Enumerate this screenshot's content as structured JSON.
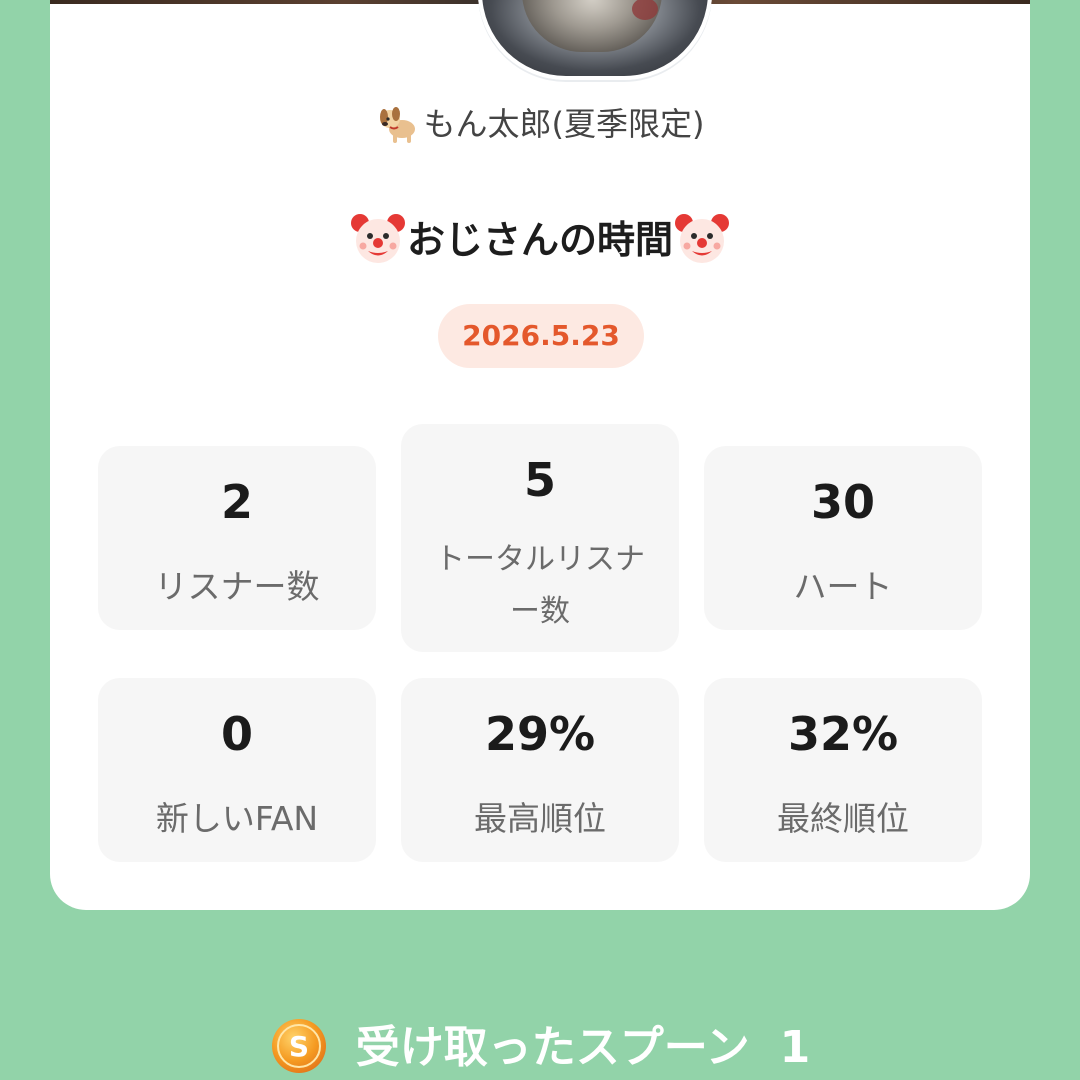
{
  "profile": {
    "owner_name": "もん太郎(夏季限定)",
    "owner_emoji": "dog-emoji",
    "avatar": "dog-avatar"
  },
  "broadcast": {
    "title": "おじさんの時間",
    "title_emoji": "clown-face-emoji",
    "date": "2026.5.23"
  },
  "stats": [
    {
      "value": "2",
      "label": "リスナー数"
    },
    {
      "value": "5",
      "label": "トータルリスナー数"
    },
    {
      "value": "30",
      "label": "ハート"
    },
    {
      "value": "0",
      "label": "新しいFAN"
    },
    {
      "value": "29%",
      "label": "最高順位"
    },
    {
      "value": "32%",
      "label": "最終順位"
    }
  ],
  "spoons": {
    "label": "受け取ったスプーン",
    "count": "1",
    "icon": "spoon-coin-icon"
  },
  "colors": {
    "background": "#92d3a9",
    "card": "#ffffff",
    "date_text": "#e4582c",
    "date_pill": "#fde9e2",
    "stat_box": "#f6f6f6"
  }
}
